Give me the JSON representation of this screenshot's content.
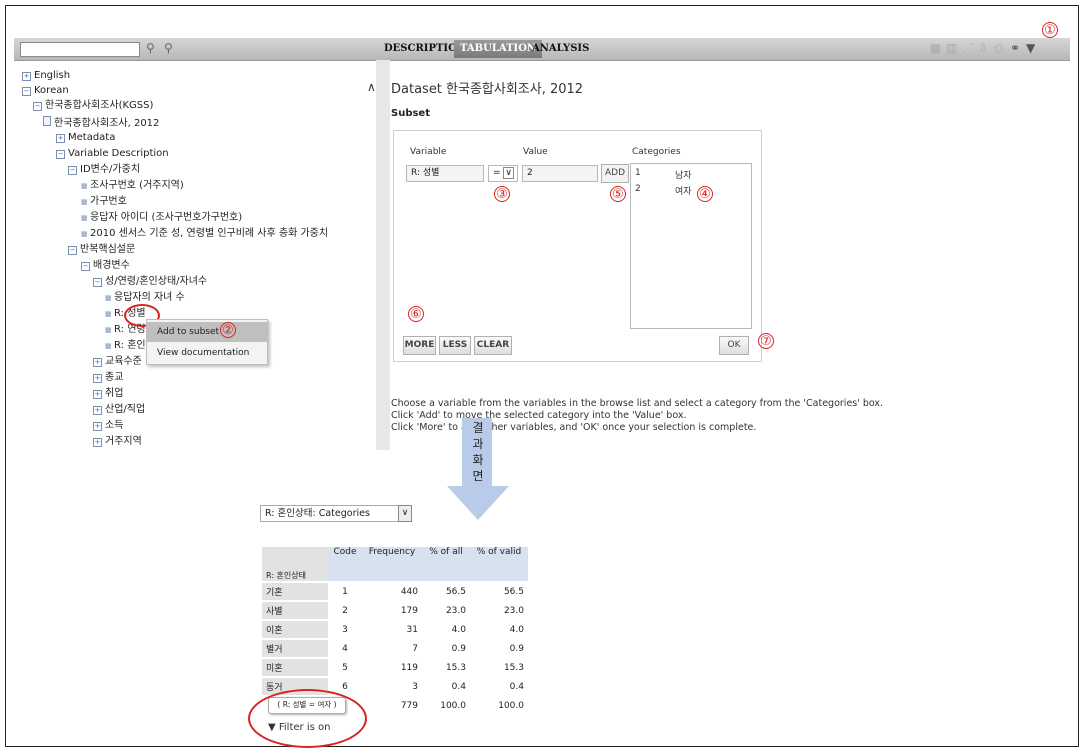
{
  "toolbar": {
    "search_placeholder": "",
    "tabs": [
      {
        "label": "DESCRIPTION"
      },
      {
        "label": "TABULATION"
      },
      {
        "label": "ANALYSIS"
      }
    ],
    "active_tab": "TABULATION"
  },
  "tree": {
    "english": "English",
    "korean": "Korean",
    "kgss": "한국종합사회조사(KGSS)",
    "dataset": "한국종합사회조사, 2012",
    "metadata": "Metadata",
    "variable_description": "Variable Description",
    "id_weight": "ID변수/가중치",
    "survey_region": "조사구번호 (거주지역)",
    "household_no": "가구번호",
    "respondent_id": "응답자 아이디 (조사구번호가구번호)",
    "census_weight": "2010 센서스 기준 성, 연령별 인구비례 사후 층화 가중치",
    "repeated_core": "반복핵심설문",
    "background": "배경변수",
    "sex_age_group": "성/연령/혼인상태/자녀수",
    "children": "응답자의 자녀 수",
    "sex": "R: 성별",
    "age": "R: 연령",
    "marital": "R: 혼인",
    "education": "교육수준",
    "religion": "종교",
    "employment": "취업",
    "industry": "산업/직업",
    "income": "소득",
    "residence": "거주지역"
  },
  "context_menu": {
    "add_to_subset": "Add to subset",
    "view_documentation": "View documentation"
  },
  "panel": {
    "dataset_title": "Dataset 한국종합사회조사, 2012",
    "subset_heading": "Subset",
    "variable_col": "Variable",
    "value_col": "Value",
    "categories_col": "Categories",
    "variable_value": "R: 성별",
    "operator": "=",
    "value": "2",
    "add_button": "ADD",
    "categories": [
      {
        "code": "1",
        "label": "남자"
      },
      {
        "code": "2",
        "label": "여자"
      }
    ],
    "more_button": "MORE",
    "less_button": "LESS",
    "clear_button": "CLEAR",
    "ok_button": "OK",
    "help_line1": "Choose a variable from the variables in the browse list and select a category from the 'Categories' box.",
    "help_line2": "Click 'Add' to move the selected category into the 'Value' box.",
    "help_line3": "Click 'More' to add other variables, and 'OK' once your selection is complete."
  },
  "annotations": {
    "markers": [
      "①",
      "②",
      "③",
      "④",
      "⑤",
      "⑥",
      "⑦"
    ],
    "arrow_text": [
      "결",
      "과",
      "화",
      "면"
    ]
  },
  "result": {
    "selector": "R: 혼인상태: Categories",
    "row_header": "R: 혼인상태",
    "columns": [
      "Code",
      "Frequency",
      "% of all",
      "% of valid"
    ],
    "rows": [
      {
        "label": "기혼",
        "code": "1",
        "freq": "440",
        "all": "56.5",
        "valid": "56.5"
      },
      {
        "label": "사별",
        "code": "2",
        "freq": "179",
        "all": "23.0",
        "valid": "23.0"
      },
      {
        "label": "이혼",
        "code": "3",
        "freq": "31",
        "all": "4.0",
        "valid": "4.0"
      },
      {
        "label": "별거",
        "code": "4",
        "freq": "7",
        "all": "0.9",
        "valid": "0.9"
      },
      {
        "label": "미혼",
        "code": "5",
        "freq": "119",
        "all": "15.3",
        "valid": "15.3"
      },
      {
        "label": "동거",
        "code": "6",
        "freq": "3",
        "all": "0.4",
        "valid": "0.4"
      }
    ],
    "total": {
      "freq": "779",
      "all": "100.0",
      "valid": "100.0"
    },
    "filter_pill": "( R: 성별 = 여자 )",
    "filter_status": "Filter is on"
  }
}
